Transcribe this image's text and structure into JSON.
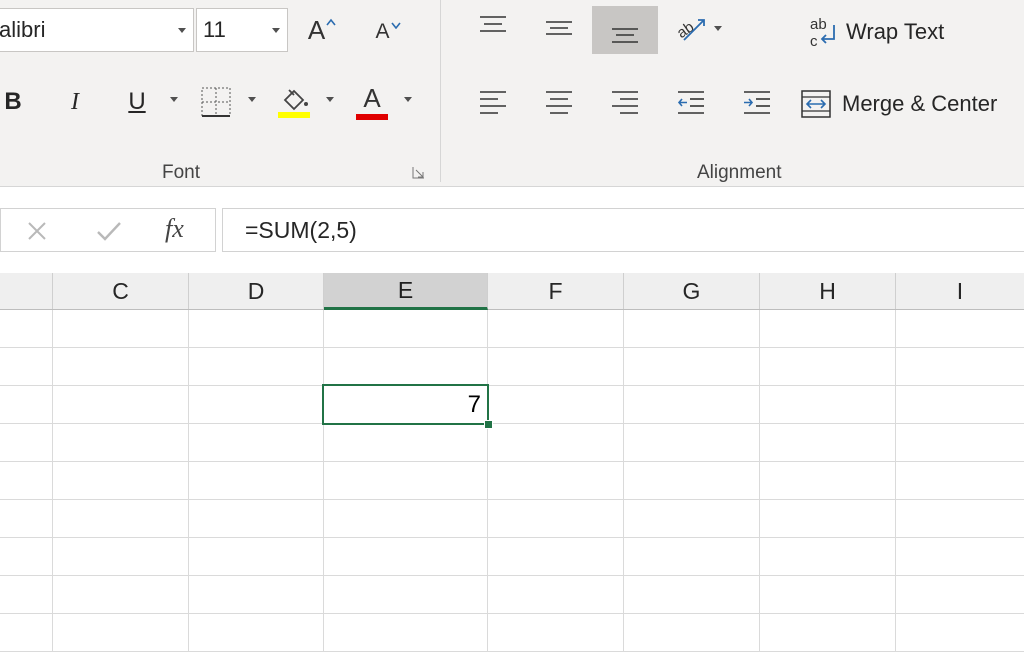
{
  "font_group": {
    "font_name": "alibri",
    "font_size": "11",
    "grow_label": "A",
    "shrink_label": "A",
    "bold_label": "B",
    "italic_label": "I",
    "underline_label": "U",
    "font_color_label": "A",
    "group_label": "Font",
    "highlight_color": "#ffff00",
    "font_color": "#e00000"
  },
  "alignment_group": {
    "wrap_text_label": "Wrap Text",
    "merge_center_label": "Merge & Center",
    "group_label": "Alignment"
  },
  "formula_bar": {
    "fx_label": "fx",
    "formula": "=SUM(2,5)"
  },
  "sheet": {
    "columns": [
      "C",
      "D",
      "E",
      "F",
      "G",
      "H",
      "I"
    ],
    "selected_column": "E",
    "active_cell_value": "7",
    "accent_color": "#217346"
  }
}
